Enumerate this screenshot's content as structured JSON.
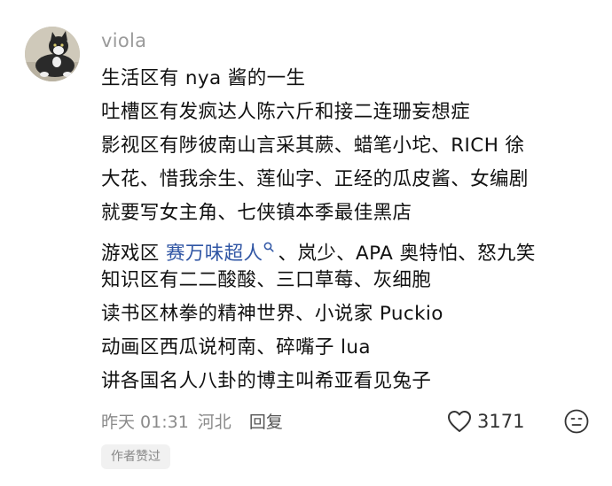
{
  "comment": {
    "username": "viola",
    "avatar_icon": "cat-avatar",
    "lines": [
      {
        "text": "生活区有 nya 酱的一生"
      },
      {
        "text": "吐槽区有发疯达人陈六斤和接二连珊妄想症"
      },
      {
        "text": "影视区有陟彼南山言采其蕨、蜡笔小坨、RICH 徐"
      },
      {
        "text": "大花、惜我余生、莲仙字、正经的瓜皮酱、女编剧"
      },
      {
        "text": "就要写女主角、七侠镇本季最佳黑店"
      },
      {
        "prefix": "游戏区 ",
        "link": "赛万味超人",
        "link_icon": "search-icon",
        "suffix": "、岚少、APA 奥特怕、怒九笑"
      },
      {
        "text": "知识区有二二酸酸、三口草莓、灰细胞"
      },
      {
        "text": "读书区林拳的精神世界、小说家 Puckio"
      },
      {
        "text": "动画区西瓜说柯南、碎嘴子 lua"
      },
      {
        "text": "讲各国名人八卦的博主叫希亚看见兔子"
      }
    ],
    "footer": {
      "time": "昨天 01:31",
      "location": "河北",
      "reply_label": "回复",
      "like_icon": "heart-icon",
      "like_count": "3171",
      "emoji_icon": "emoji-icon"
    },
    "author_badge": "作者赞过"
  },
  "colors": {
    "link": "#2f55a4",
    "username": "#9a9a9a",
    "meta": "#8a8a8a"
  }
}
